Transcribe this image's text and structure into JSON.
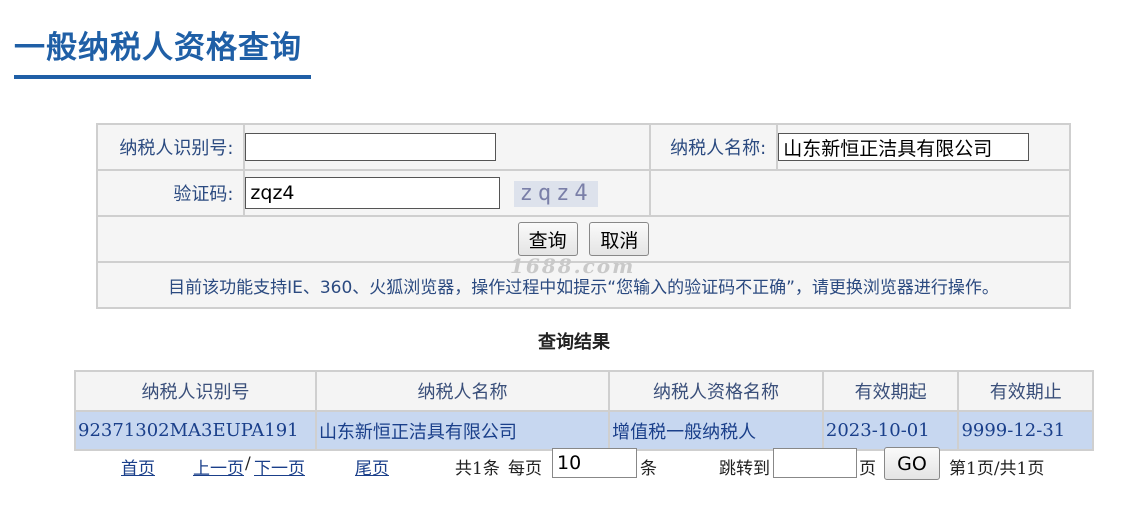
{
  "page_title": "一般纳税人资格查询",
  "form": {
    "taxpayer_id_label": "纳税人识别号:",
    "taxpayer_id_value": "",
    "taxpayer_name_label": "纳税人名称:",
    "taxpayer_name_value": "山东新恒正洁具有限公司",
    "captcha_label": "验证码:",
    "captcha_value": "zqz4",
    "captcha_image_text": "zqz4",
    "search_button": "查询",
    "cancel_button": "取消",
    "notice": "目前该功能支持IE、360、火狐浏览器，操作过程中如提示“您输入的验证码不正确”，请更换浏览器进行操作。"
  },
  "watermark": "1688.com",
  "results": {
    "title": "查询结果",
    "columns": [
      "纳税人识别号",
      "纳税人名称",
      "纳税人资格名称",
      "有效期起",
      "有效期止"
    ],
    "rows": [
      [
        "92371302MA3EUPA191",
        "山东新恒正洁具有限公司",
        "增值税一般纳税人",
        "2023-10-01",
        "9999-12-31"
      ]
    ]
  },
  "pager": {
    "first": "首页",
    "prev": "上一页",
    "separator": "/",
    "next": "下一页",
    "last": "尾页",
    "total": "共1条",
    "per_page_label": "每页",
    "per_page_value": "10",
    "per_page_unit": "条",
    "jump_label": "跳转到",
    "jump_value": "",
    "page_unit": "页",
    "go_button": "GO",
    "status": "第1页/共1页"
  },
  "colors": {
    "title": "#1f5fa6",
    "label_text": "#2b4a80",
    "row_highlight": "#c7d7f0",
    "border": "#cfcfcf"
  }
}
